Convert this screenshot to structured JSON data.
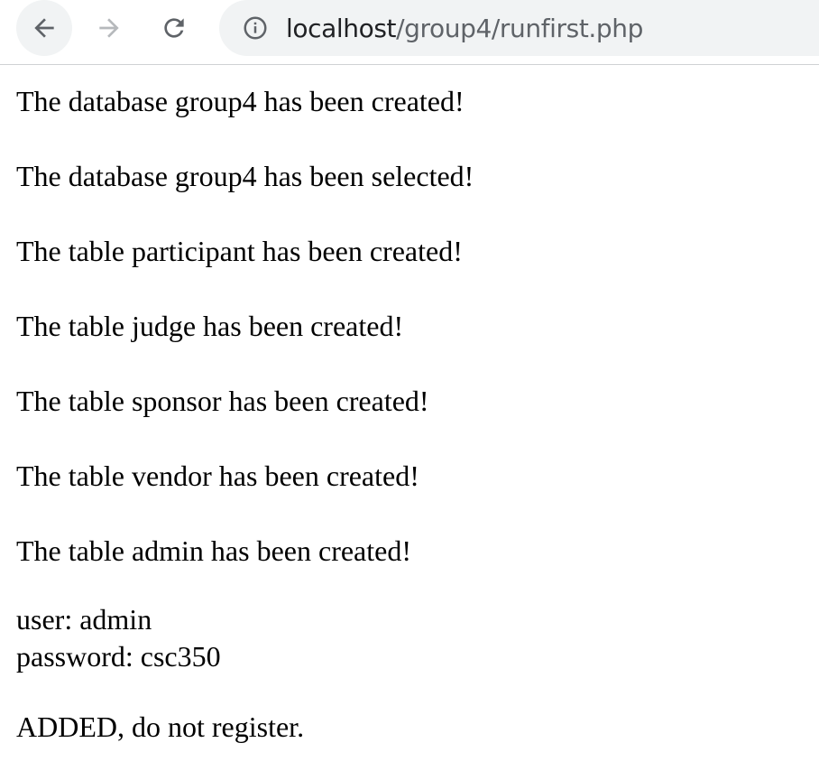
{
  "browser": {
    "url_host": "localhost",
    "url_path": "/group4/runfirst.php",
    "icons": {
      "back": "back-arrow-icon",
      "forward": "forward-arrow-icon",
      "reload": "reload-icon",
      "site_info": "info-icon"
    }
  },
  "page": {
    "messages": [
      "The database group4 has been created!",
      "The database group4 has been selected!",
      "The table participant has been created!",
      "The table judge has been created!",
      "The table sponsor has been created!",
      "The table vendor has been created!",
      "The table admin has been created!"
    ],
    "credentials": {
      "user_line": "user: admin",
      "password_line": "password: csc350"
    },
    "final_message": "ADDED, do not register."
  },
  "colors": {
    "toolbar_bg": "#ffffff",
    "omnibox_bg": "#f1f3f4",
    "icon_active": "#5f6368",
    "icon_disabled": "#b6b9bc",
    "url_host": "#202124",
    "url_path": "#5f6368"
  }
}
